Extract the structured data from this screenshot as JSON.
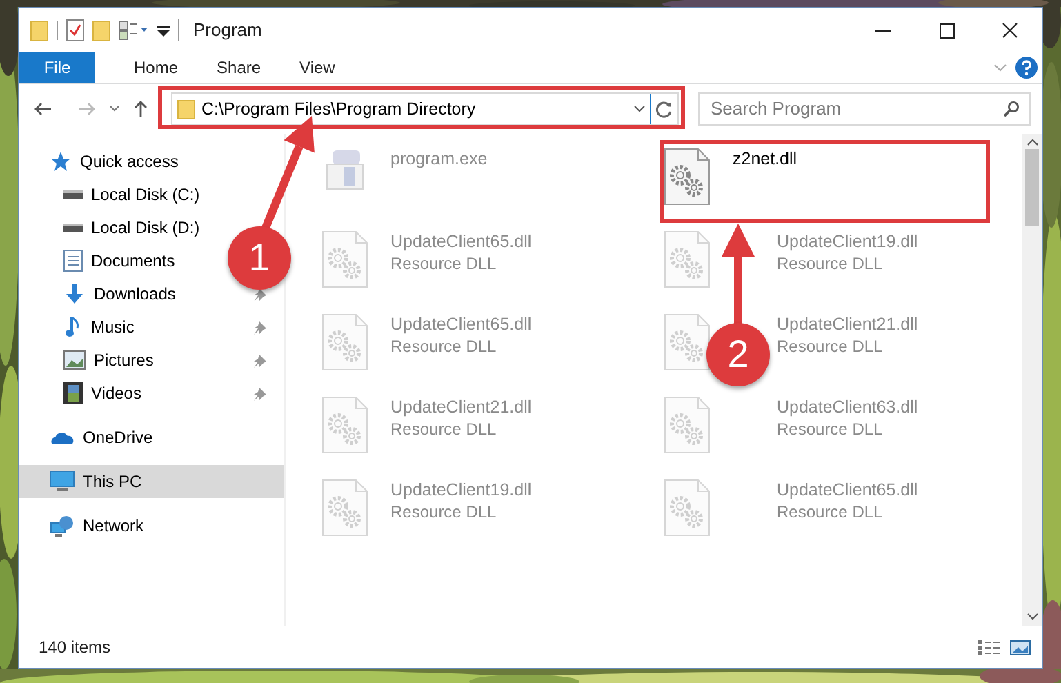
{
  "window": {
    "title": "Program"
  },
  "ribbon_tabs": [
    {
      "label": "File",
      "selected": true
    },
    {
      "label": "Home",
      "selected": false
    },
    {
      "label": "Share",
      "selected": false
    },
    {
      "label": "View",
      "selected": false
    }
  ],
  "address_bar": {
    "path": "C:\\Program Files\\Program Directory"
  },
  "search": {
    "placeholder": "Search Program"
  },
  "sidebar": {
    "items": [
      {
        "label": "Quick access",
        "selected": false,
        "children": [
          {
            "label": "Local Disk (C:)",
            "pinned": false,
            "selected": false
          },
          {
            "label": "Local Disk (D:)",
            "pinned": false,
            "selected": false
          },
          {
            "label": "Documents",
            "pinned": false,
            "selected": false
          },
          {
            "label": "Downloads",
            "pinned": true,
            "selected": false
          },
          {
            "label": "Music",
            "pinned": true,
            "selected": false
          },
          {
            "label": "Pictures",
            "pinned": true,
            "selected": false
          },
          {
            "label": "Videos",
            "pinned": true,
            "selected": false
          }
        ]
      },
      {
        "label": "OneDrive",
        "selected": false
      },
      {
        "label": "This PC",
        "selected": true
      },
      {
        "label": "Network",
        "selected": false
      }
    ]
  },
  "files": [
    {
      "name": "program.exe",
      "kind": "exe",
      "dimmed": true
    },
    {
      "name": "z2net.dll",
      "kind": "dll",
      "dimmed": false
    },
    {
      "name": "UpdateClient65.dll",
      "type": "Resource DLL",
      "kind": "dll",
      "dimmed": true
    },
    {
      "name": "UpdateClient19.dll",
      "type": "Resource DLL",
      "kind": "dll",
      "dimmed": true
    },
    {
      "name": "UpdateClient65.dll",
      "type": "Resource DLL",
      "kind": "dll",
      "dimmed": true
    },
    {
      "name": "UpdateClient21.dll",
      "type": "Resource DLL",
      "kind": "dll",
      "dimmed": true
    },
    {
      "name": "UpdateClient21.dll",
      "type": "Resource DLL",
      "kind": "dll",
      "dimmed": true
    },
    {
      "name": "UpdateClient63.dll",
      "type": "Resource DLL",
      "kind": "dll",
      "dimmed": true
    },
    {
      "name": "UpdateClient19.dll",
      "type": "Resource DLL",
      "kind": "dll",
      "dimmed": true
    },
    {
      "name": "UpdateClient65.dll",
      "type": "Resource DLL",
      "kind": "dll",
      "dimmed": true
    }
  ],
  "status_bar": {
    "item_count": "140 items"
  },
  "annotations": [
    {
      "number": "1"
    },
    {
      "number": "2"
    }
  ]
}
